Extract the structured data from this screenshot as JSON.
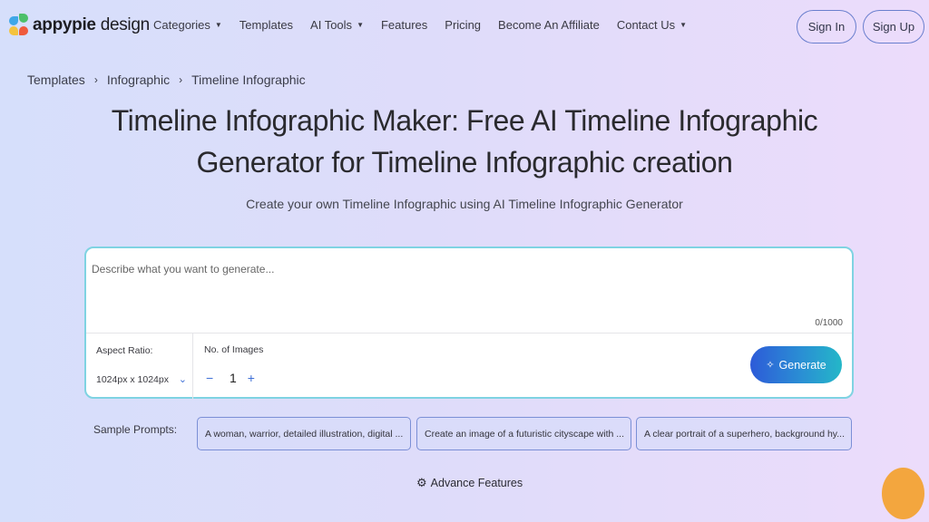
{
  "brand": {
    "bold": "appypie",
    "light": "design"
  },
  "nav": {
    "items": [
      {
        "label": "Categories",
        "dropdown": true
      },
      {
        "label": "Templates",
        "dropdown": false
      },
      {
        "label": "AI Tools",
        "dropdown": true
      },
      {
        "label": "Features",
        "dropdown": false
      },
      {
        "label": "Pricing",
        "dropdown": false
      },
      {
        "label": "Become An Affiliate",
        "dropdown": false
      },
      {
        "label": "Contact Us",
        "dropdown": true
      }
    ],
    "caret": "▼"
  },
  "auth": {
    "sign_in": "Sign In",
    "sign_up": "Sign Up"
  },
  "breadcrumb": {
    "items": [
      "Templates",
      "Infographic",
      "Timeline Infographic"
    ],
    "separator": "›"
  },
  "hero": {
    "title_line1": "Timeline Infographic Maker: Free AI Timeline Infographic",
    "title_line2": "Generator for Timeline Infographic creation",
    "subtitle": "Create your own Timeline Infographic using AI Timeline Infographic Generator"
  },
  "prompt": {
    "placeholder": "Describe what you want to generate...",
    "value": "",
    "counter": "0/1000",
    "aspect_label": "Aspect Ratio:",
    "aspect_value": "1024px x 1024px",
    "num_label": "No. of Images",
    "num_value": "1",
    "minus": "−",
    "plus": "+",
    "generate": "Generate"
  },
  "samples": {
    "label": "Sample Prompts:",
    "items": [
      "A woman, warrior, detailed illustration, digital ...",
      "Create an image of a futuristic cityscape with ...",
      "A clear portrait of a superhero, background hy..."
    ]
  },
  "advance": {
    "label": "Advance Features"
  },
  "colors": {
    "accent_blue": "#2d5bd8",
    "accent_teal": "#24b7c8",
    "chat_bubble": "#f3a63e",
    "prompt_border": "#7fd3e2"
  }
}
